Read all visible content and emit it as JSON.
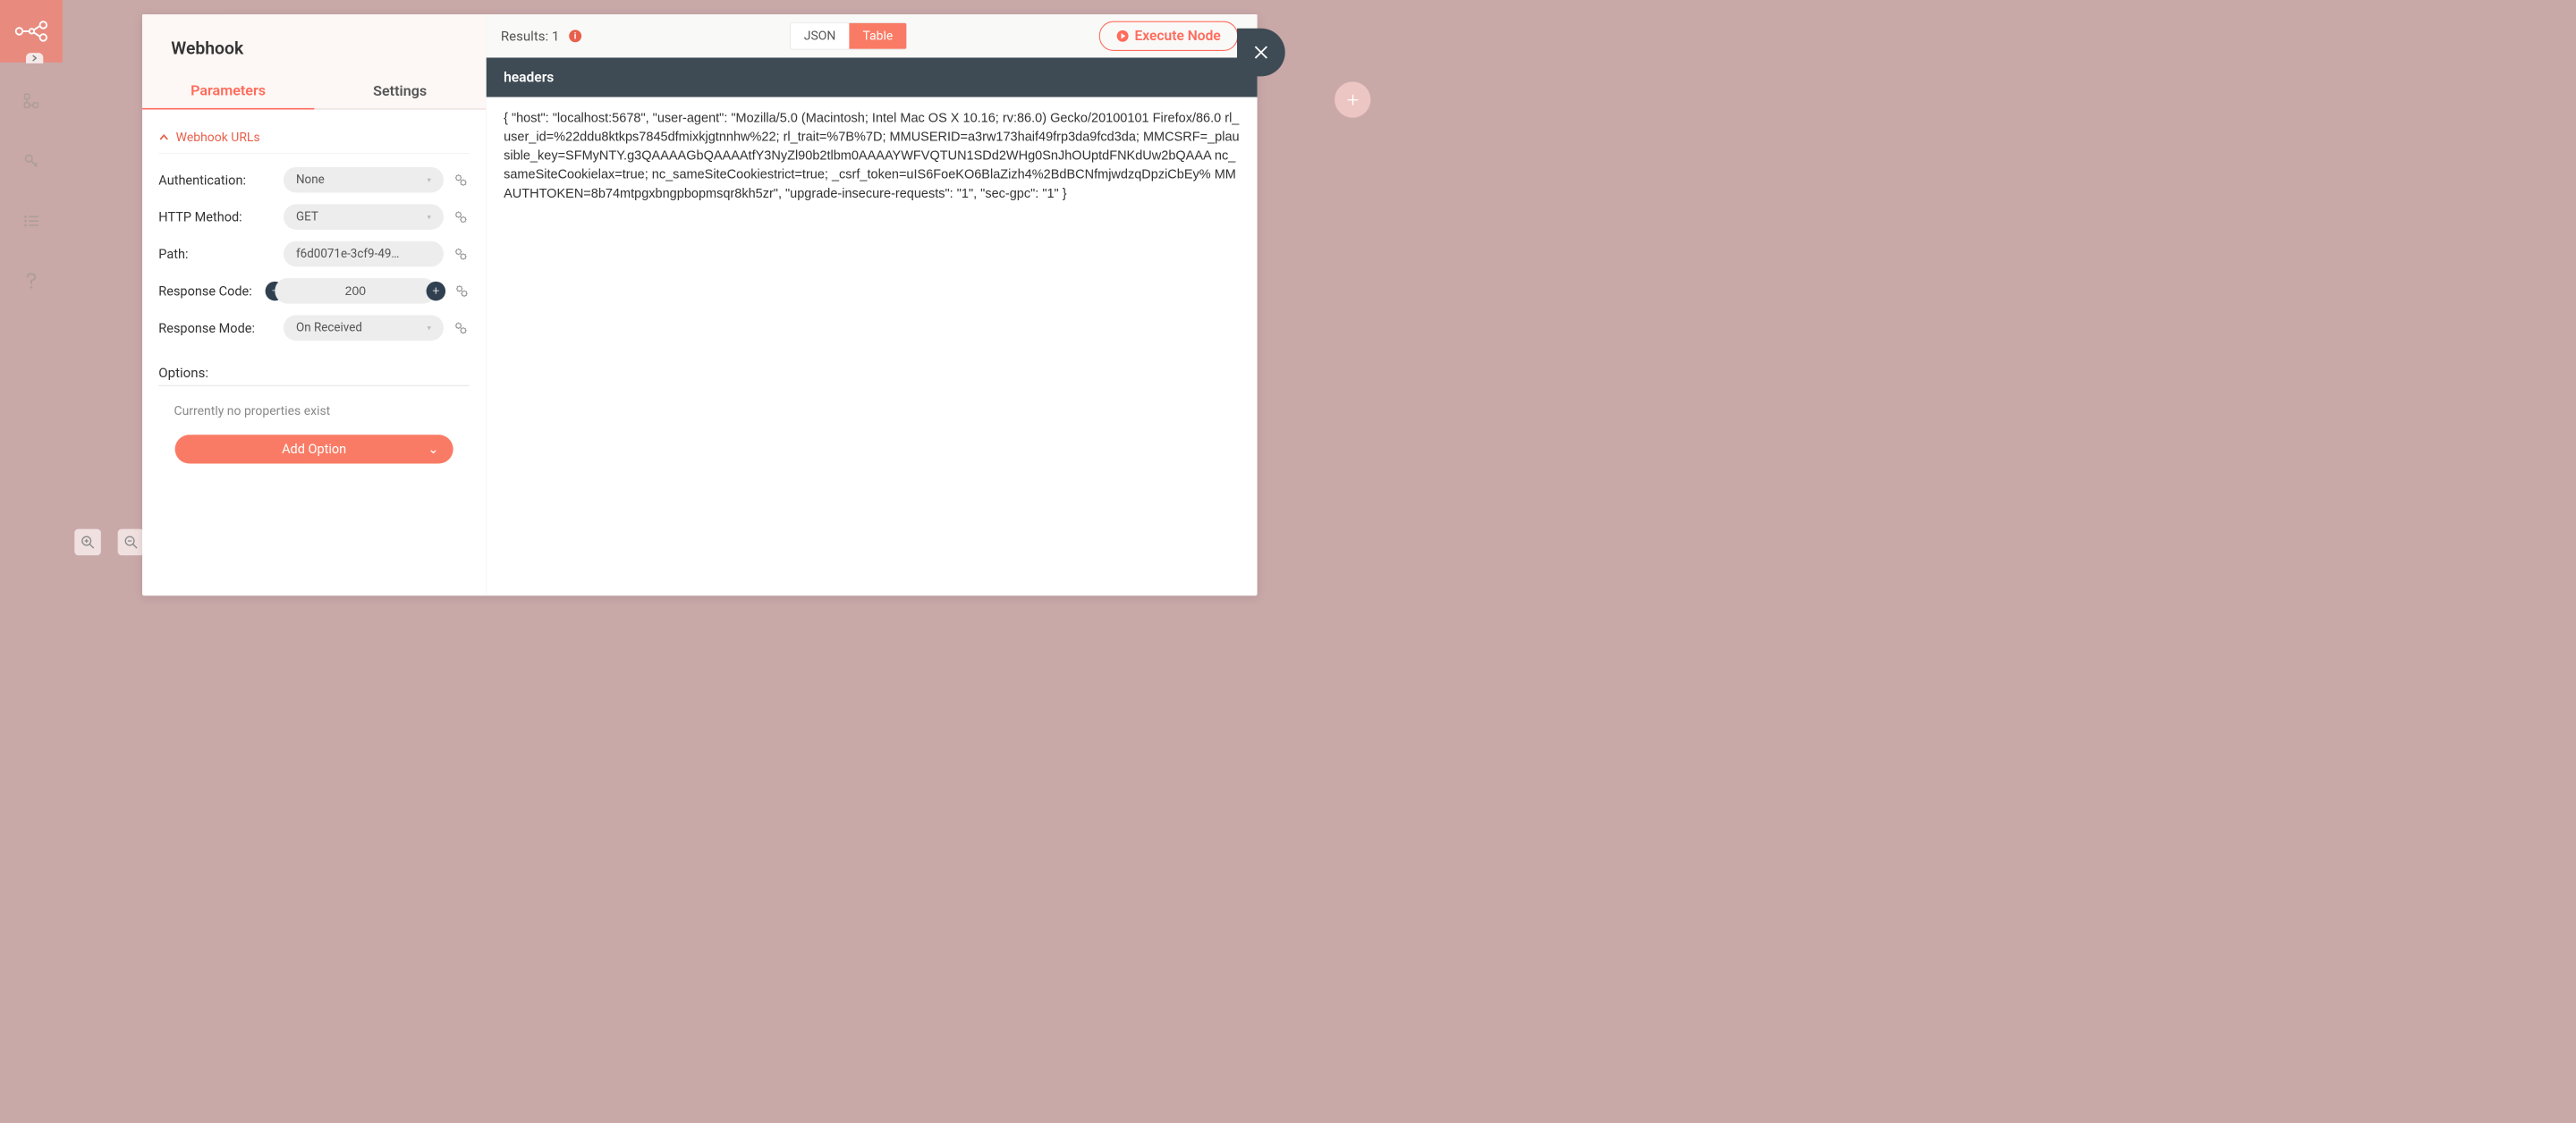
{
  "sidebar": {
    "icons": [
      "workflow",
      "key",
      "list",
      "help"
    ]
  },
  "modal": {
    "title": "Webhook",
    "tabs": {
      "parameters": "Parameters",
      "settings": "Settings"
    },
    "section": "Webhook URLs",
    "fields": {
      "authentication": {
        "label": "Authentication:",
        "value": "None"
      },
      "httpMethod": {
        "label": "HTTP Method:",
        "value": "GET"
      },
      "path": {
        "label": "Path:",
        "value": "f6d0071e-3cf9-49…"
      },
      "responseCode": {
        "label": "Response Code:",
        "value": "200"
      },
      "responseMode": {
        "label": "Response Mode:",
        "value": "On Received"
      }
    },
    "options": {
      "header": "Options:",
      "empty": "Currently no properties exist",
      "addBtn": "Add Option"
    }
  },
  "results": {
    "label": "Results: 1",
    "viewJson": "JSON",
    "viewTable": "Table",
    "executeBtn": "Execute Node",
    "columnHeader": "headers",
    "content": "{ \"host\": \"localhost:5678\", \"user-agent\": \"Mozilla/5.0 (Macintosh; Intel Mac OS X 10.16; rv:86.0) Gecko/20100101 Firefox/86.0 rl_user_id=%22ddu8ktkps7845dfmixkjgtnnhw%22; rl_trait=%7B%7D; MMUSERID=a3rw173haif49frp3da9fcd3da; MMCSRF=_plausible_key=SFMyNTY.g3QAAAAGbQAAAAtfY3NyZl90b2tlbm0AAAAYWFVQTUN1SDd2WHg0SnJhOUptdFNKdUw2bQAAA nc_sameSiteCookielax=true; nc_sameSiteCookiestrict=true; _csrf_token=uIS6FoeKO6BlaZizh4%2BdBCNfmjwdzqDpziCbEy% MMAUTHTOKEN=8b74mtpgxbngpbopmsqr8kh5zr\", \"upgrade-insecure-requests\": \"1\", \"sec-gpc\": \"1\" }"
  }
}
